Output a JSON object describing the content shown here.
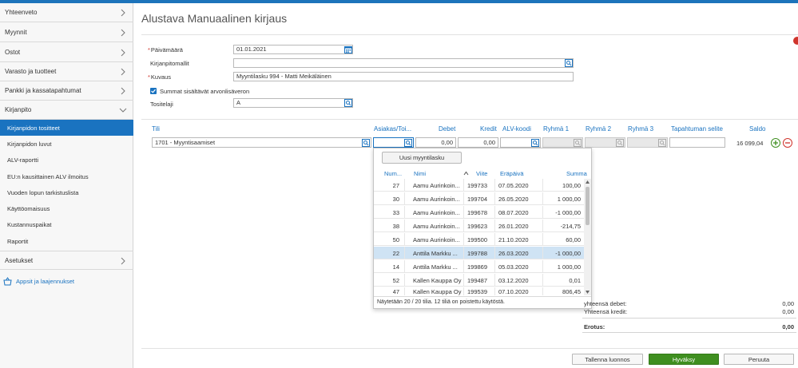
{
  "sidebar": {
    "items": [
      {
        "label": "Yhteenveto"
      },
      {
        "label": "Myynnit"
      },
      {
        "label": "Ostot"
      },
      {
        "label": "Varasto ja tuotteet"
      },
      {
        "label": "Pankki ja kassatapahtumat"
      },
      {
        "label": "Kirjanpito"
      }
    ],
    "subitems": [
      {
        "label": "Kirjanpidon tositteet",
        "active": true
      },
      {
        "label": "Kirjanpidon luvut"
      },
      {
        "label": "ALV-raportti"
      },
      {
        "label": "EU:n kausittainen ALV ilmoitus"
      },
      {
        "label": "Vuoden lopun tarkistuslista"
      },
      {
        "label": "Käyttöomaisuus"
      },
      {
        "label": "Kustannuspaikat"
      },
      {
        "label": "Raportit"
      }
    ],
    "settings": {
      "label": "Asetukset"
    },
    "apps": {
      "label": "Appsit ja laajennukset"
    }
  },
  "page": {
    "title": "Alustava Manuaalinen kirjaus"
  },
  "form": {
    "date": {
      "label": "Päivämäärä",
      "value": "01.01.2021",
      "required": "*"
    },
    "template": {
      "label": "Kirjanpitomallit",
      "value": ""
    },
    "description": {
      "label": "Kuvaus",
      "value": "Myyntilasku 994 - Matti Meikäläinen",
      "required": "*"
    },
    "vat_included": {
      "label": "Summat sisältävät arvonlisäveron",
      "checked": true
    },
    "voucher_type": {
      "label": "Tositelaji",
      "value": "A"
    }
  },
  "grid": {
    "headers": {
      "account": "Tili",
      "customer": "Asiakas/Toi...",
      "debit": "Debet",
      "credit": "Kredit",
      "vat": "ALV-koodi",
      "group1": "Ryhmä 1",
      "group2": "Ryhmä 2",
      "group3": "Ryhmä 3",
      "event": "Tapahtuman selite",
      "balance": "Saldo"
    },
    "row": {
      "account": "1701 - Myyntisaamiset",
      "customer": "",
      "debit": "0,00",
      "credit": "0,00",
      "vat": "",
      "event": "",
      "balance": "16 099,04"
    }
  },
  "dropdown": {
    "new_invoice_label": "Uusi myyntilasku",
    "headers": {
      "number": "Num...",
      "name": "Nimi",
      "reference": "Viite",
      "due": "Eräpäivä",
      "amount": "Summa"
    },
    "rows": [
      {
        "number": "27",
        "name": "Aamu Aurinkoin...",
        "reference": "199733",
        "due": "07.05.2020",
        "amount": "100,00"
      },
      {
        "number": "30",
        "name": "Aamu Aurinkoin...",
        "reference": "199704",
        "due": "26.05.2020",
        "amount": "1 000,00"
      },
      {
        "number": "33",
        "name": "Aamu Aurinkoin...",
        "reference": "199678",
        "due": "08.07.2020",
        "amount": "-1 000,00"
      },
      {
        "number": "38",
        "name": "Aamu Aurinkoin...",
        "reference": "199623",
        "due": "26.01.2020",
        "amount": "-214,75"
      },
      {
        "number": "50",
        "name": "Aamu Aurinkoin...",
        "reference": "199500",
        "due": "21.10.2020",
        "amount": "60,00"
      },
      {
        "number": "22",
        "name": "Anttila Markku ...",
        "reference": "199788",
        "due": "26.03.2020",
        "amount": "-1 000,00",
        "selected": true
      },
      {
        "number": "14",
        "name": "Anttila Markku ...",
        "reference": "199869",
        "due": "05.03.2020",
        "amount": "1 000,00"
      },
      {
        "number": "52",
        "name": "Kallen Kauppa Oy",
        "reference": "199487",
        "due": "03.12.2020",
        "amount": "0,01"
      },
      {
        "number": "47",
        "name": "Kallen Kauppa Oy",
        "reference": "199539",
        "due": "07.10.2020",
        "amount": "806,45"
      }
    ],
    "footer": "Näytetään 20 / 20 tilia. 12 tiliä on poistettu käytöstä."
  },
  "totals": {
    "debit_label": "yhteensä debet:",
    "debit_value": "0,00",
    "credit_label": "Yhteensä kredit:",
    "credit_value": "0,00",
    "diff_label": "Erotus:",
    "diff_value": "0,00"
  },
  "buttons": {
    "save_draft": "Tallenna luonnos",
    "approve": "Hyväksy",
    "cancel": "Peruuta"
  },
  "colors": {
    "accent": "#1a73c0",
    "approve": "#3f8f20",
    "danger": "#d0342c"
  }
}
